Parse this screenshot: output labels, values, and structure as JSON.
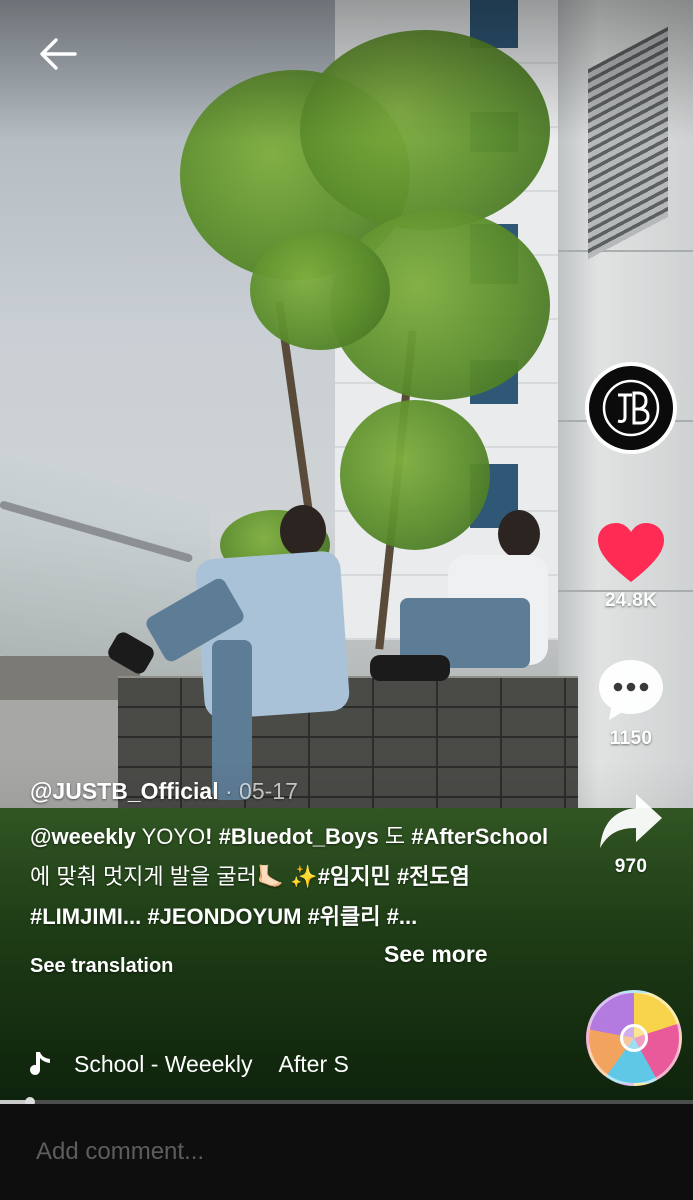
{
  "video": {
    "author": "@JUSTB_Official",
    "date_separator": " · ",
    "date": "05-17",
    "description": [
      {
        "text": "@weeekly",
        "tag": true
      },
      {
        "text": " YOYO",
        "tag": false
      },
      {
        "text": "! ",
        "tag": true
      },
      {
        "text": "#Bluedot_Boys",
        "tag": true
      },
      {
        "text": " 도 ",
        "tag": false
      },
      {
        "text": "#AfterSchool",
        "tag": true
      },
      {
        "text": " 에 맞춰 멋지게 발을 굴러",
        "tag": false
      },
      {
        "text": "🦶🏻 ✨",
        "tag": false
      },
      {
        "text": "#임지민",
        "tag": true
      },
      {
        "text": " ",
        "tag": false
      },
      {
        "text": "#전도염",
        "tag": true
      },
      {
        "text": " ",
        "tag": false
      },
      {
        "text": "#LIMJIMI...",
        "tag": true
      },
      {
        "text": " ",
        "tag": false
      },
      {
        "text": "#JEONDOYUM",
        "tag": true
      },
      {
        "text": " ",
        "tag": false
      },
      {
        "text": "#위클리",
        "tag": true
      },
      {
        "text": " ",
        "tag": false
      },
      {
        "text": "#...",
        "tag": true
      }
    ],
    "see_more": "See more",
    "see_translation": "See translation"
  },
  "actions": {
    "likes": "24.8K",
    "comments": "1150",
    "shares": "970"
  },
  "music": {
    "track": "School - Weeekly",
    "track_repeat": "After S"
  },
  "playback": {
    "progress": 0.043
  },
  "comment": {
    "placeholder": "Add comment..."
  },
  "colors": {
    "like": "#fe2c55",
    "background": "#0e0e0e"
  },
  "icons": {
    "back": "arrow-left-icon",
    "like": "heart-icon",
    "comment": "speech-bubble-icon",
    "share": "share-arrow-icon",
    "music": "music-note-icon",
    "avatar": "jb-logo"
  }
}
